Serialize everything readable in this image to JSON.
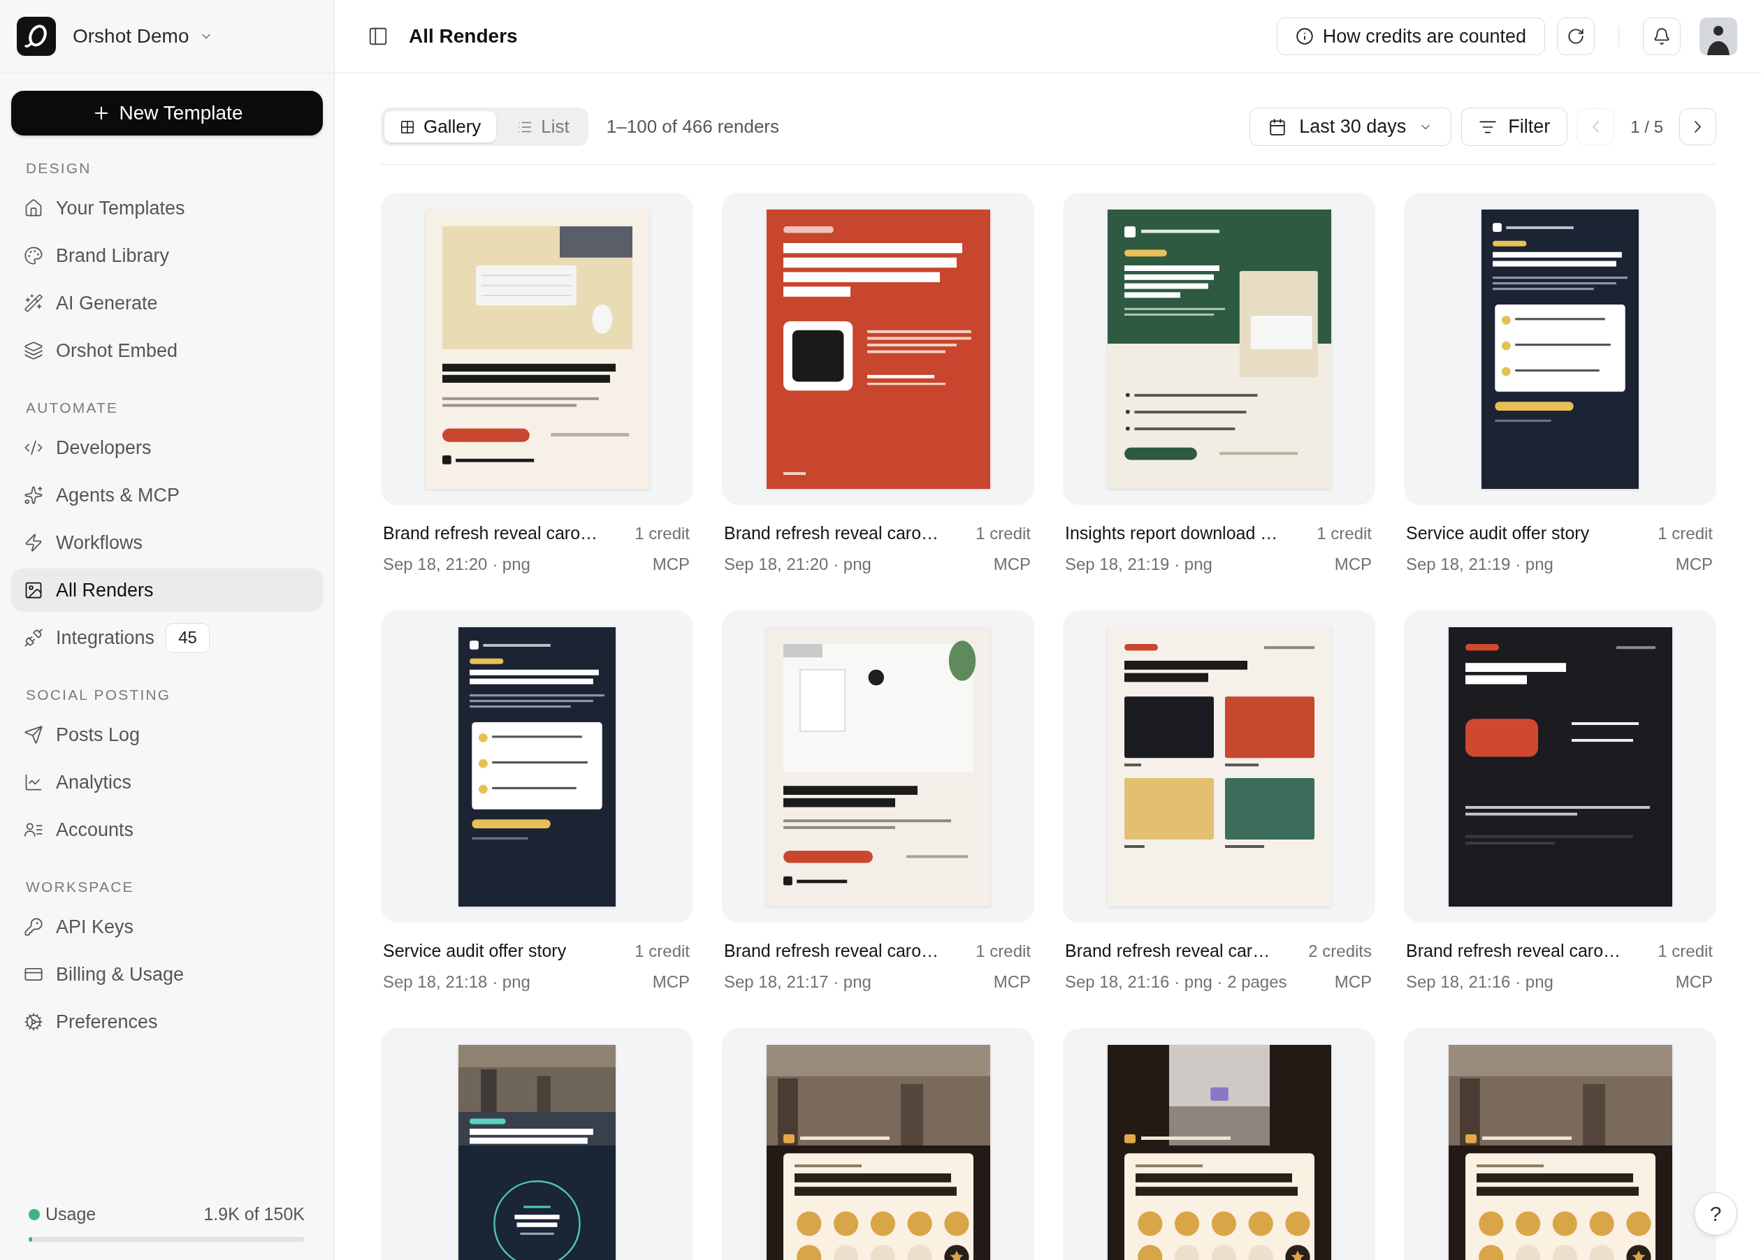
{
  "workspace": {
    "name": "Orshot Demo"
  },
  "new_template": {
    "label": "New Template"
  },
  "sidebar": {
    "sections": [
      {
        "heading": "DESIGN",
        "items": [
          {
            "label": "Your Templates",
            "selected": false
          },
          {
            "label": "Brand Library",
            "selected": false
          },
          {
            "label": "AI Generate",
            "selected": false
          },
          {
            "label": "Orshot Embed",
            "selected": false
          }
        ]
      },
      {
        "heading": "AUTOMATE",
        "items": [
          {
            "label": "Developers",
            "selected": false
          },
          {
            "label": "Agents & MCP",
            "selected": false
          },
          {
            "label": "Workflows",
            "selected": false
          },
          {
            "label": "All Renders",
            "selected": true
          },
          {
            "label": "Integrations",
            "selected": false,
            "badge": "45"
          }
        ]
      },
      {
        "heading": "SOCIAL POSTING",
        "items": [
          {
            "label": "Posts Log",
            "selected": false
          },
          {
            "label": "Analytics",
            "selected": false
          },
          {
            "label": "Accounts",
            "selected": false
          }
        ]
      },
      {
        "heading": "WORKSPACE",
        "items": [
          {
            "label": "API Keys",
            "selected": false
          },
          {
            "label": "Billing & Usage",
            "selected": false
          },
          {
            "label": "Preferences",
            "selected": false
          }
        ]
      }
    ]
  },
  "usage": {
    "label": "Usage",
    "reading": "1.9K of 150K",
    "level": 0.013
  },
  "header": {
    "title": "All Renders",
    "credits_button": "How credits are counted"
  },
  "toolbar": {
    "view_tabs": [
      {
        "label": "Gallery",
        "selected": true
      },
      {
        "label": "List",
        "selected": false
      }
    ],
    "count": "1–100 of 466 renders",
    "date_range": "Last 30 days",
    "filter": "Filter",
    "pagination": {
      "page": "1 / 5",
      "previous_disabled": true,
      "next_disabled": false
    }
  },
  "renders": [
    {
      "kind": "desk",
      "title": "Brand refresh reveal caro…",
      "credits": "1 credit",
      "meta": "Sep 18, 21:20 · png",
      "source": "MCP"
    },
    {
      "kind": "brand",
      "title": "Brand refresh reveal caro…",
      "credits": "1 credit",
      "meta": "Sep 18, 21:20 · png",
      "source": "MCP"
    },
    {
      "kind": "report",
      "title": "Insights report download …",
      "credits": "1 credit",
      "meta": "Sep 18, 21:19 · png",
      "source": "MCP"
    },
    {
      "kind": "story",
      "title": "Service audit offer story",
      "credits": "1 credit",
      "meta": "Sep 18, 21:19 · png",
      "source": "MCP"
    },
    {
      "kind": "story",
      "title": "Service audit offer story",
      "credits": "1 credit",
      "meta": "Sep 18, 21:18 · png",
      "source": "MCP"
    },
    {
      "kind": "workspace",
      "title": "Brand refresh reveal caro…",
      "credits": "1 credit",
      "meta": "Sep 18, 21:17 · png",
      "source": "MCP"
    },
    {
      "kind": "palette",
      "title": "Brand refresh reveal car…",
      "credits": "2 credits",
      "meta": "Sep 18, 21:16 · png · 2 pages",
      "source": "MCP"
    },
    {
      "kind": "type",
      "title": "Brand refresh reveal caro…",
      "credits": "1 credit",
      "meta": "Sep 18, 21:16 · png",
      "source": "MCP"
    },
    {
      "kind": "kitchen"
    },
    {
      "kind": "rewards"
    },
    {
      "kind": "placeholder"
    },
    {
      "kind": "rewards"
    }
  ],
  "help_button": "?"
}
